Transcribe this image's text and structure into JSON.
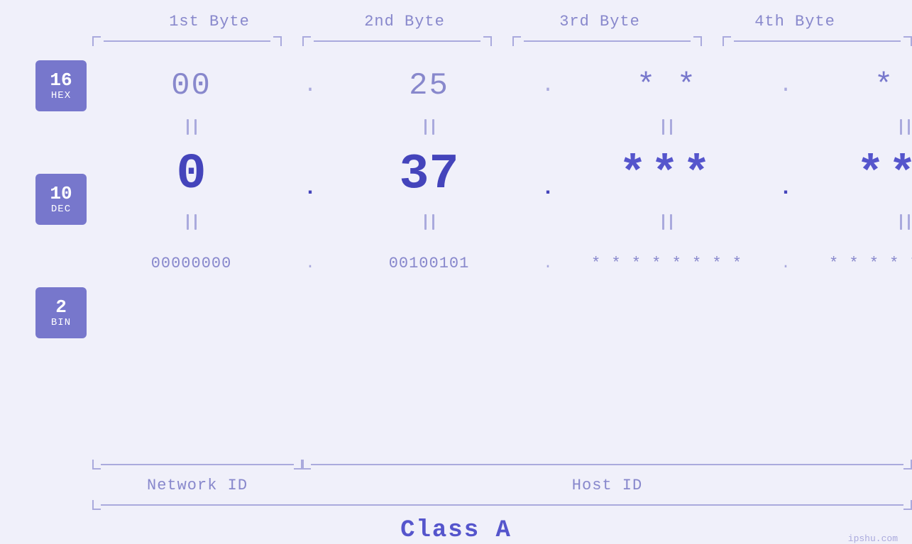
{
  "headers": {
    "byte1": "1st Byte",
    "byte2": "2nd Byte",
    "byte3": "3rd Byte",
    "byte4": "4th Byte"
  },
  "labels": {
    "hex": {
      "num": "16",
      "base": "HEX"
    },
    "dec": {
      "num": "10",
      "base": "DEC"
    },
    "bin": {
      "num": "2",
      "base": "BIN"
    }
  },
  "bytes": [
    {
      "hex": "00",
      "dec": "0",
      "bin": "00000000",
      "masked": false
    },
    {
      "hex": "25",
      "dec": "37",
      "bin": "00100101",
      "masked": false
    },
    {
      "hex": "**",
      "dec": "***",
      "bin": "********",
      "masked": true
    },
    {
      "hex": "**",
      "dec": "***",
      "bin": "********",
      "masked": true
    }
  ],
  "labels_bottom": {
    "network": "Network ID",
    "host": "Host ID",
    "class": "Class A"
  },
  "watermark": "ipshu.com"
}
